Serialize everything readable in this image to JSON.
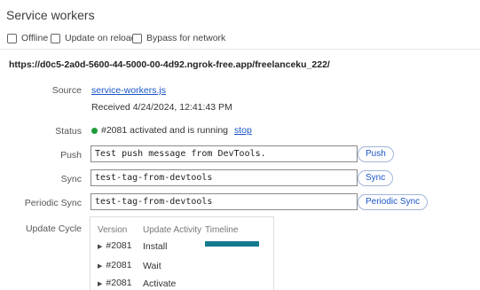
{
  "panel": {
    "title": "Service workers",
    "options": [
      {
        "label": "Offline",
        "checked": false
      },
      {
        "label": "Update on reload",
        "checked": false
      },
      {
        "label": "Bypass for network",
        "checked": false
      }
    ]
  },
  "worker": {
    "origin": "https://d0c5-2a0d-5600-44-5000-00-4d92.ngrok-free.app/freelanceku_222/",
    "source_label": "Source",
    "source_file": "service-workers.js",
    "received": "Received 4/24/2024, 12:41:43 PM",
    "status_label": "Status",
    "status_text": "#2081 activated and is running",
    "status_action": "stop",
    "status_color": "#1f9b3a",
    "push": {
      "label": "Push",
      "value": "Test push message from DevTools.",
      "button": "Push"
    },
    "sync": {
      "label": "Sync",
      "value": "test-tag-from-devtools",
      "button": "Sync"
    },
    "periodic_sync": {
      "label": "Periodic Sync",
      "value": "test-tag-from-devtools",
      "button": "Periodic Sync"
    }
  },
  "update_cycle": {
    "label": "Update Cycle",
    "headers": {
      "version": "Version",
      "activity": "Update Activity",
      "timeline": "Timeline"
    },
    "rows": [
      {
        "version": "#2081",
        "activity": "Install"
      },
      {
        "version": "#2081",
        "activity": "Wait"
      },
      {
        "version": "#2081",
        "activity": "Activate"
      }
    ],
    "timeline_color": "#147b8f"
  }
}
